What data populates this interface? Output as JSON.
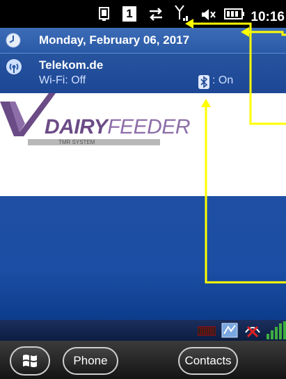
{
  "status_bar": {
    "clock": "10:16",
    "page_indicator": "1",
    "icons": [
      "windows-phone-icon",
      "page-one-icon",
      "sync-arrows-icon",
      "signal-antenna-icon",
      "speaker-mute-icon",
      "battery-icon"
    ]
  },
  "notification": {
    "date": "Monday, February 06, 2017",
    "carrier": "Telekom.de",
    "wifi_status": "Wi-Fi: Off",
    "bluetooth_status": ": On"
  },
  "logo": {
    "brand_bold": "DAIRY",
    "brand_light": "FEEDER",
    "tagline": "TMR SYSTEM"
  },
  "taskbar": {
    "phone_label": "Phone",
    "contacts_label": "Contacts"
  },
  "colors": {
    "annotation_yellow": "#ffff00",
    "logo_purple": "#6b4b86",
    "header_blue": "#2a5aa6",
    "desktop_blue": "#1b4ea4"
  }
}
